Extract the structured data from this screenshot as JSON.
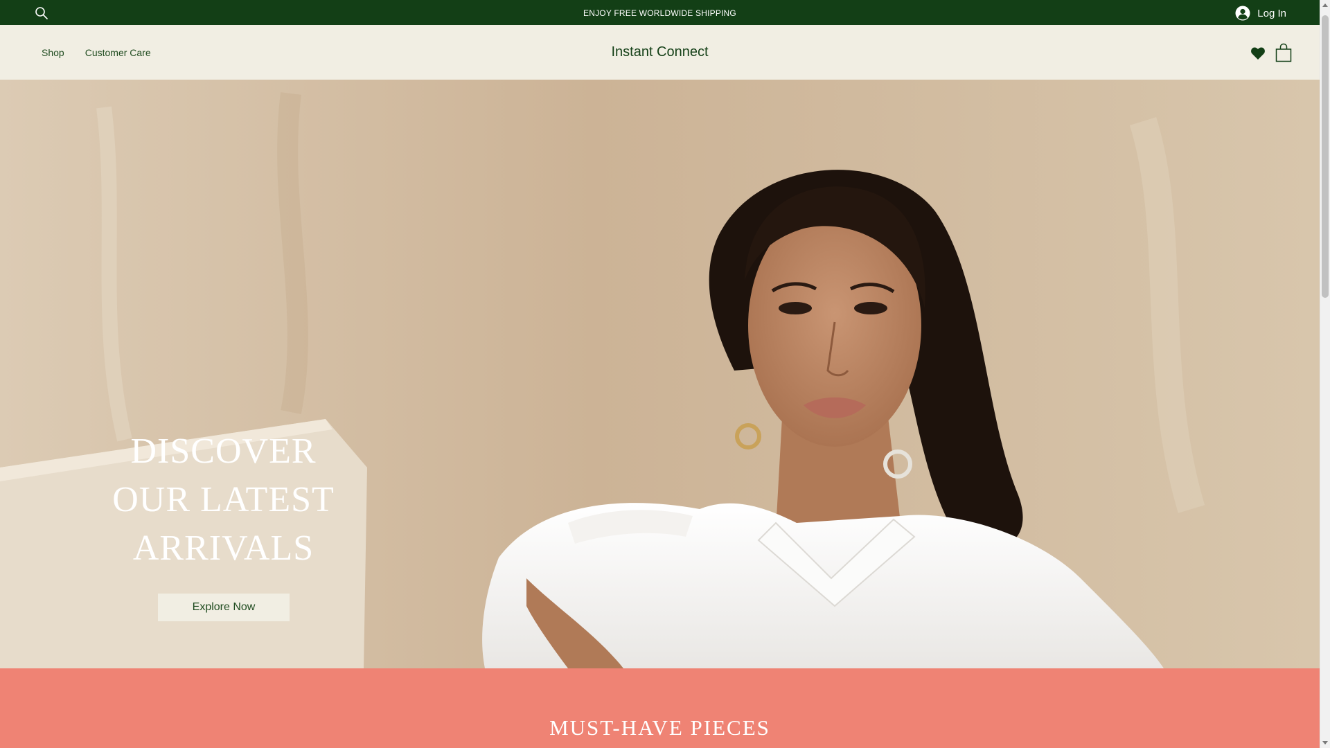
{
  "announcement": {
    "text": "ENJOY FREE WORLDWIDE SHIPPING",
    "login_label": "Log In",
    "search_icon": "search-icon",
    "avatar_icon": "user-avatar-icon",
    "background_color": "#133f16"
  },
  "header": {
    "nav": [
      {
        "label": "Shop"
      },
      {
        "label": "Customer Care"
      }
    ],
    "brand": "Instant Connect",
    "wishlist_icon": "heart-icon",
    "cart_icon": "shopping-bag-icon",
    "background_color": "#f1eee3"
  },
  "hero": {
    "headline": [
      "DISCOVER",
      "OUR LATEST",
      "ARRIVALS"
    ],
    "cta_label": "Explore Now",
    "image": "model-in-white-ribbed-shirt-photo"
  },
  "section": {
    "title": "MUST-HAVE PIECES",
    "background_color": "#ef8374"
  }
}
